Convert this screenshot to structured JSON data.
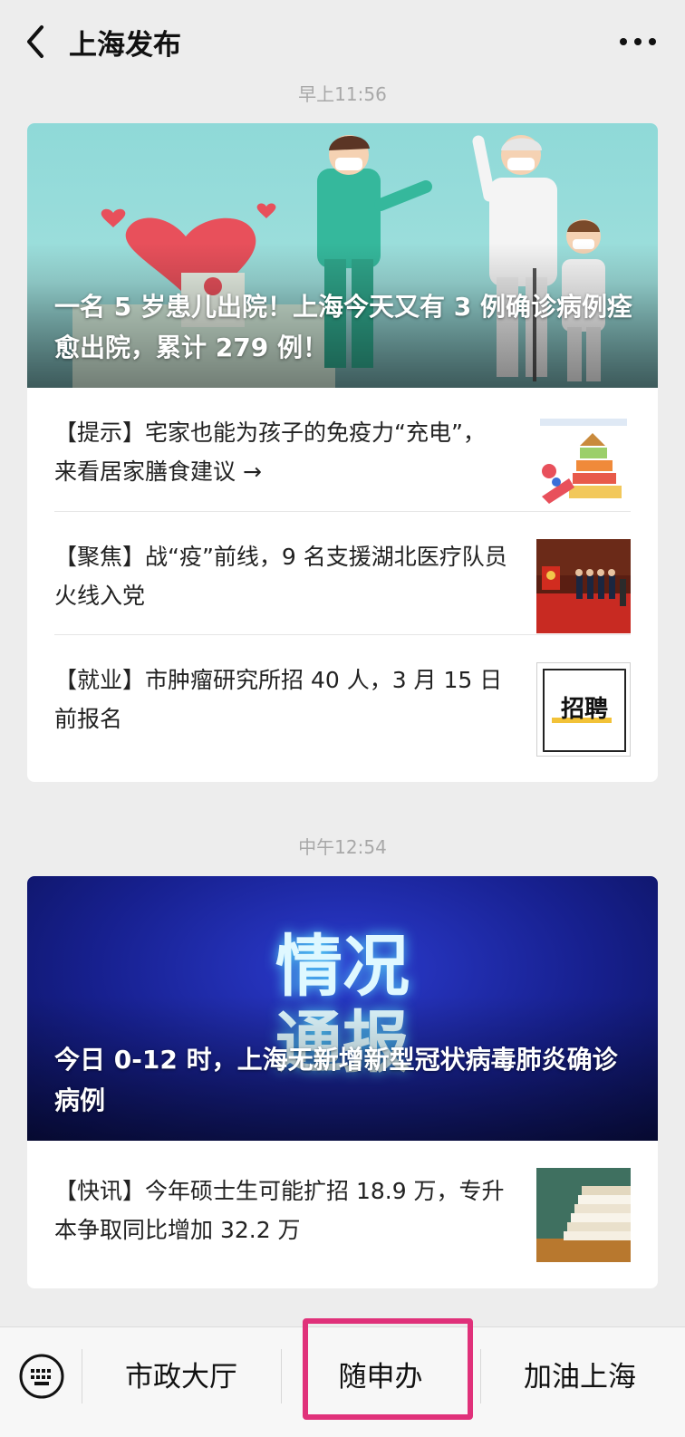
{
  "header": {
    "title": "上海发布",
    "back_icon": "chevron-left-icon",
    "more_icon": "more-dots-icon"
  },
  "messages": [
    {
      "time": "早上11:56",
      "headline": "一名 5 岁患儿出院！上海今天又有 3 例确诊病例痊愈出院，累计 279 例！",
      "items": [
        {
          "text": "【提示】宅家也能为孩子的免疫力“充电”，来看居家膳食建议 →"
        },
        {
          "text": "【聚焦】战“疫”前线，9 名支援湖北医疗队员火线入党"
        },
        {
          "text": "【就业】市肿瘤研究所招 40 人，3 月 15 日前报名",
          "thumb_text": "招聘"
        }
      ]
    },
    {
      "time": "中午12:54",
      "hero_text": "情况\n通报",
      "headline": "今日 0-12 时，上海无新增新型冠状病毒肺炎确诊病例",
      "items": [
        {
          "text": "【快讯】今年硕士生可能扩招 18.9 万，专升本争取同比增加 32.2 万"
        }
      ]
    }
  ],
  "bottom_menu": {
    "keyboard_icon": "keyboard-icon",
    "items": [
      "市政大厅",
      "随申办",
      "加油上海"
    ],
    "highlighted": "随申办",
    "highlight_color": "#e0317a"
  }
}
